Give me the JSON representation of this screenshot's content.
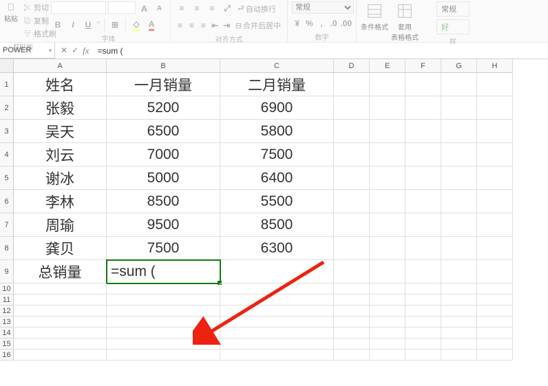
{
  "ribbon": {
    "clipboard": {
      "paste": "粘贴",
      "cut": "剪切",
      "copy": "复制",
      "format_painter": "格式刷",
      "label": "剪贴板"
    },
    "font": {
      "label": "字体",
      "bold": "B",
      "italic": "I",
      "underline": "U",
      "inc": "A",
      "dec": "A"
    },
    "alignment": {
      "label": "对齐方式",
      "wrap": "自动换行",
      "merge": "合并后居中"
    },
    "number": {
      "label": "数字",
      "general": "常规"
    },
    "styles": {
      "cond_fmt": "条件格式",
      "table_fmt": "套用\n表格格式",
      "general_style": "常规",
      "good": "好"
    },
    "styles_label": "样"
  },
  "formula_bar": {
    "name_box": "POWER",
    "formula": "=sum ("
  },
  "columns": [
    "A",
    "B",
    "C",
    "D",
    "E",
    "F",
    "G",
    "H"
  ],
  "grid": {
    "headers": {
      "a": "姓名",
      "b": "一月销量",
      "c": "二月销量"
    },
    "rows": [
      {
        "a": "张毅",
        "b": "5200",
        "c": "6900"
      },
      {
        "a": "吴天",
        "b": "6500",
        "c": "5800"
      },
      {
        "a": "刘云",
        "b": "7000",
        "c": "7500"
      },
      {
        "a": "谢冰",
        "b": "5000",
        "c": "6400"
      },
      {
        "a": "李林",
        "b": "8500",
        "c": "5500"
      },
      {
        "a": "周瑜",
        "b": "9500",
        "c": "8500"
      },
      {
        "a": "龚贝",
        "b": "7500",
        "c": "6300"
      }
    ],
    "total_label": "总销量",
    "active_formula": "=sum  ("
  }
}
